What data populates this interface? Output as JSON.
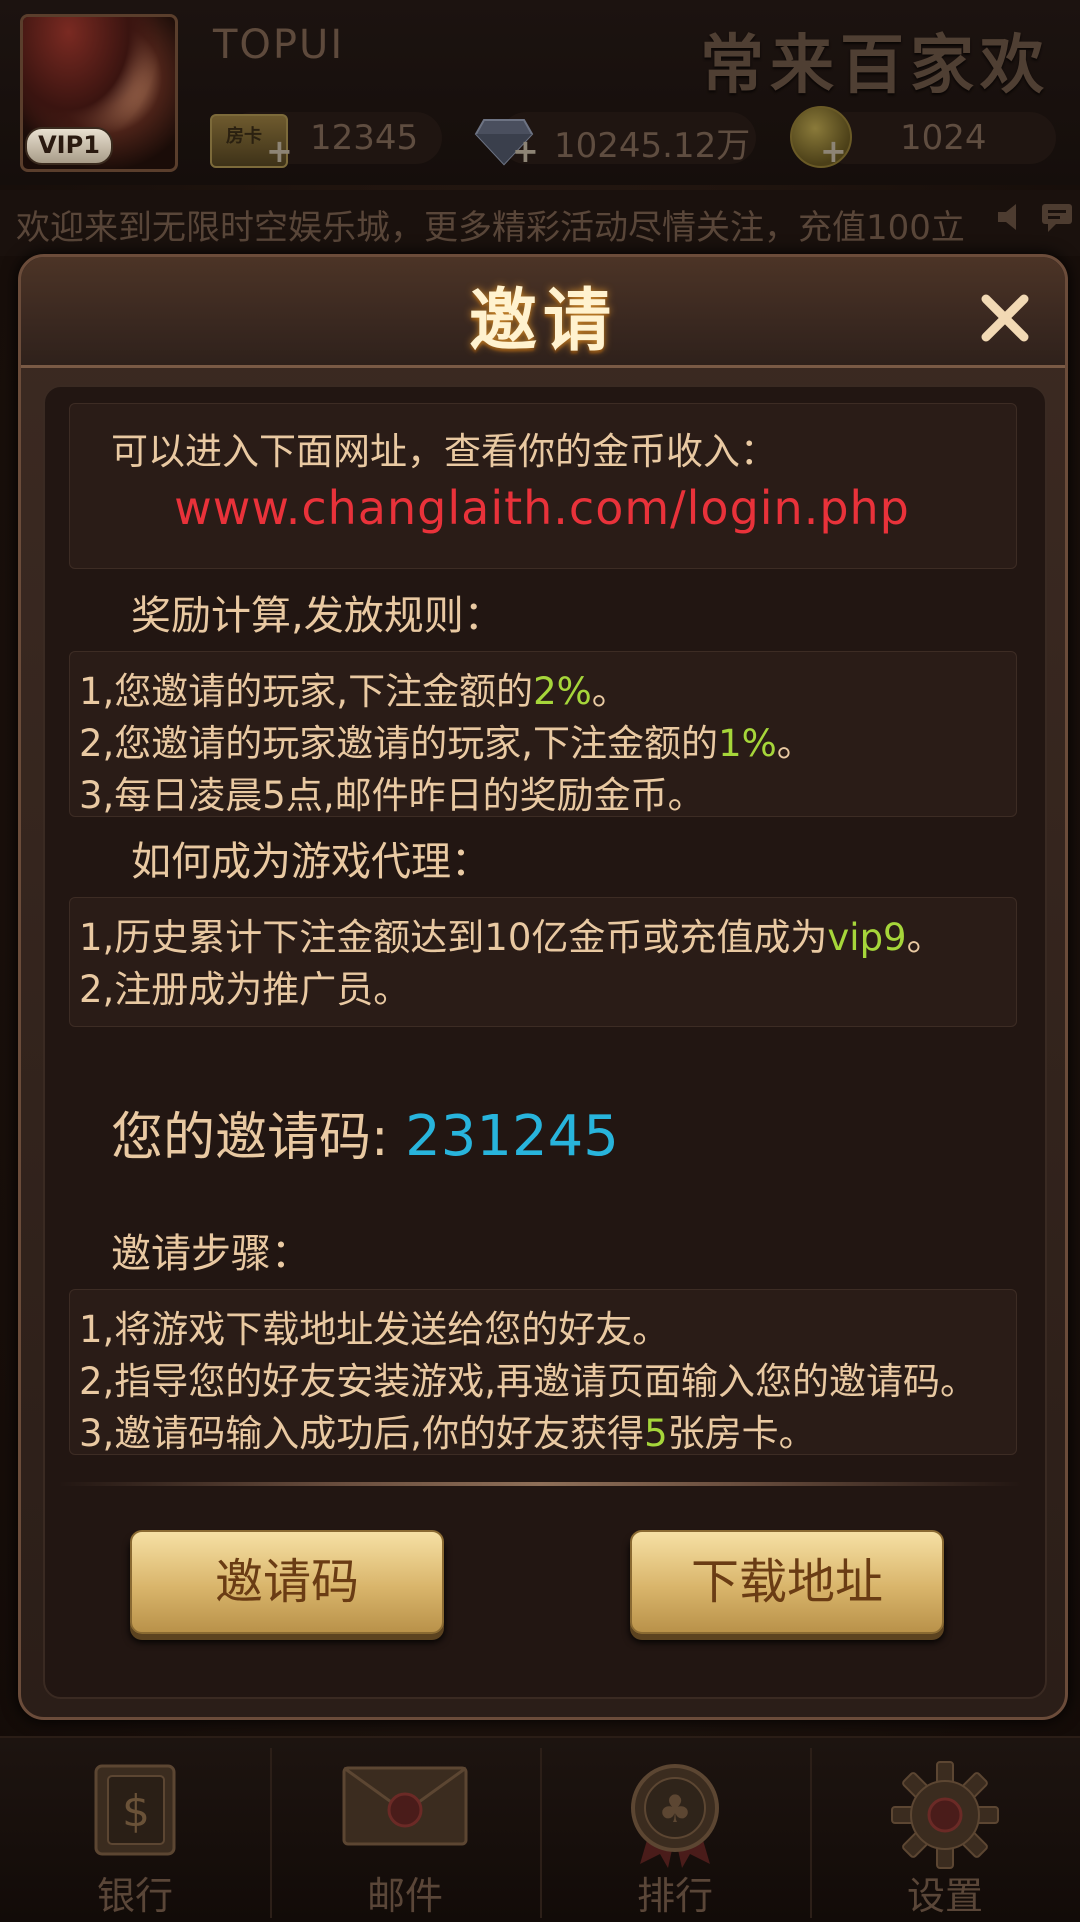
{
  "top": {
    "username": "TOPUI",
    "title_art": "常来百家欢",
    "vip": "VIP1",
    "room_card_icon_text": "房卡",
    "room_cards": "12345",
    "diamonds": "10245.12万",
    "coins": "1024"
  },
  "ticker": {
    "text": "欢迎来到无限时空娱乐城，更多精彩活动尽情关注，充值100立"
  },
  "dialog": {
    "title": "邀请",
    "site_prompt": "可以进入下面网址，查看你的金币收入：",
    "url": "www.changlaith.com/login.php",
    "rules_title": "奖励计算,发放规则：",
    "rules": [
      {
        "pre": "1,您邀请的玩家,下注金额的",
        "hi": "2%",
        "post": "。"
      },
      {
        "pre": "2,您邀请的玩家邀请的玩家,下注金额的",
        "hi": "1%",
        "post": "。"
      },
      {
        "pre": "3,每日凌晨5点,邮件昨日的奖励金币。",
        "hi": "",
        "post": ""
      }
    ],
    "agent_title": "如何成为游戏代理：",
    "agent": [
      {
        "pre": "1,历史累计下注金额达到10亿金币或充值成为",
        "hi": "vip9",
        "post": "。"
      },
      {
        "pre": "2,注册成为推广员。",
        "hi": "",
        "post": ""
      }
    ],
    "invite_code_label": "您的邀请码:",
    "invite_code": "231245",
    "steps_title": "邀请步骤：",
    "steps": [
      {
        "pre": "1,将游戏下载地址发送给您的好友。",
        "hi": "",
        "post": ""
      },
      {
        "pre": "2,指导您的好友安装游戏,再邀请页面输入您的邀请码。",
        "hi": "",
        "post": ""
      },
      {
        "pre": "3,邀请码输入成功后,你的好友获得",
        "hi": "5",
        "post": "张房卡。"
      }
    ],
    "btn_invite_code": "邀请码",
    "btn_download": "下载地址"
  },
  "nav": {
    "bank": "银行",
    "mail": "邮件",
    "rank": "排行",
    "settings": "设置"
  },
  "colors": {
    "accent_green": "#a6d63a",
    "url_red": "#e9323a",
    "code_blue": "#28b4dc",
    "text_cream": "#e9c9a2"
  }
}
